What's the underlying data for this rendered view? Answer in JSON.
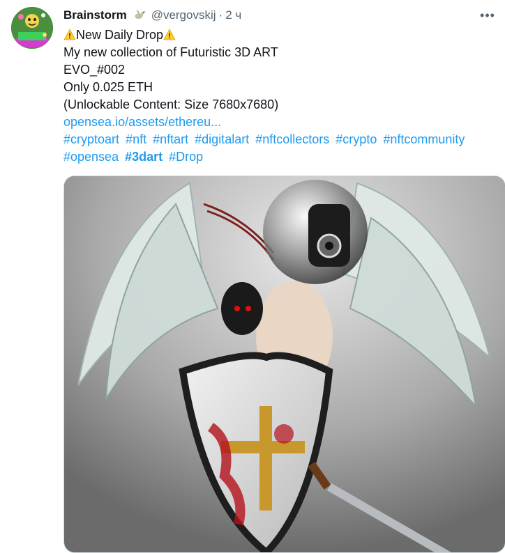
{
  "tweet": {
    "display_name": "Brainstorm",
    "handle": "@vergovskij",
    "separator": "·",
    "time": "2 ч",
    "more_label": "•••",
    "lines": [
      "New Daily Drop",
      "My new collection of Futuristic 3D ART",
      "EVO_#002",
      "Only 0.025 ETH",
      "(Unlockable Content: Size 7680x7680)"
    ],
    "link": "opensea.io/assets/ethereu...",
    "hashtags_row1": [
      "#cryptoart",
      "#nft",
      "#nftart",
      "#digitalart",
      "#nftcollectors",
      "#crypto",
      "#nftcommunity"
    ],
    "hashtags_row2": [
      "#opensea",
      "#3dart",
      "#Drop"
    ]
  },
  "colors": {
    "link": "#1d9bf0",
    "text": "#0f1419",
    "secondary": "#536471"
  },
  "icons": {
    "warning": "warning-icon",
    "verified_like": "bird-emoji-icon",
    "more": "more-horizontal-icon"
  }
}
